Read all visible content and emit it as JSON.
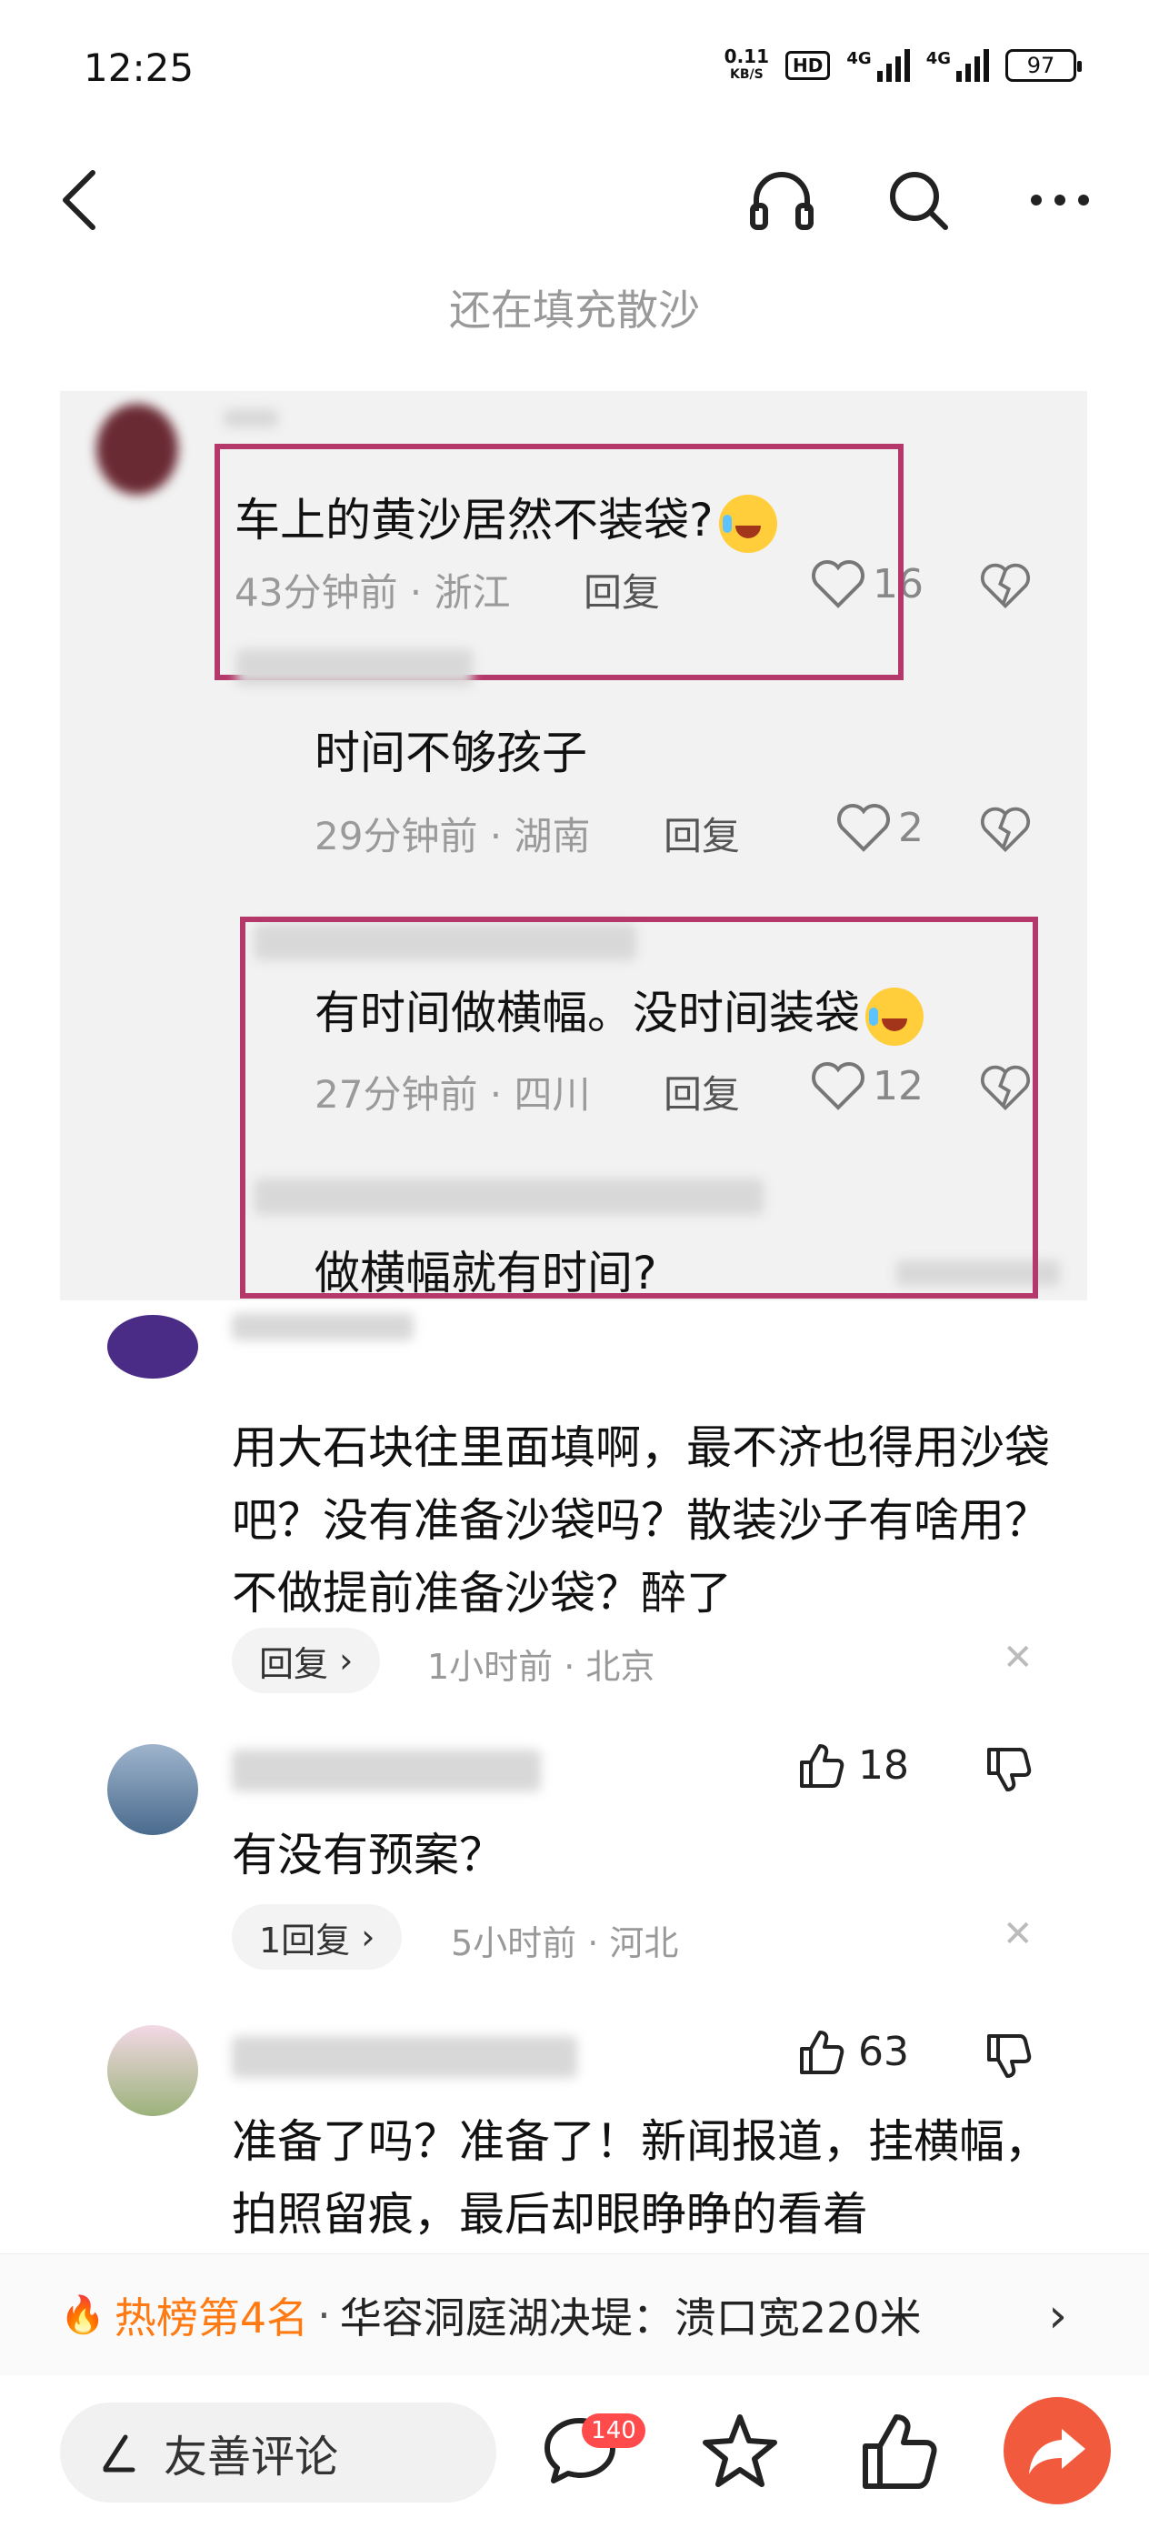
{
  "status_bar": {
    "time": "12:25",
    "net_speed_value": "0.11",
    "net_speed_unit": "KB/S",
    "hd_label": "HD",
    "sim1": "4G",
    "sim2": "4G",
    "battery": "97"
  },
  "nav": {
    "caption": "还在填充散沙",
    "icons": [
      "back-icon",
      "headphones-icon",
      "search-icon",
      "more-icon"
    ]
  },
  "inner_screenshot": {
    "comment": {
      "text": "车上的黄沙居然不装袋?",
      "time": "43分钟前",
      "location": "浙江",
      "reply": "回复",
      "likes": "16"
    },
    "replies": [
      {
        "text": "时间不够孩子",
        "time": "29分钟前",
        "location": "湖南",
        "reply": "回复",
        "likes": "2"
      },
      {
        "text": "有时间做横幅。没时间装袋",
        "time": "27分钟前",
        "location": "四川",
        "reply": "回复",
        "likes": "12"
      },
      {
        "text": "做横幅就有时间?"
      }
    ]
  },
  "comments": [
    {
      "text": "用大石块往里面填啊，最不济也得用沙袋吧？没有准备沙袋吗？散装沙子有啥用？不做提前准备沙袋？醉了",
      "reply_label": "回复",
      "time_location": "1小时前 · 北京"
    },
    {
      "text": "有没有预案？",
      "reply_label": "1回复",
      "time_location": "5小时前 · 河北",
      "likes": "18"
    },
    {
      "text": "准备了吗？准备了！新闻报道，挂横幅，拍照留痕，最后却眼睁睁的看着",
      "likes": "63"
    }
  ],
  "hot_banner": {
    "rank": "热榜第4名",
    "separator": "·",
    "title": "华容洞庭湖决堤：溃口宽220米"
  },
  "bottom_bar": {
    "input_placeholder": "友善评论",
    "comment_count": "140"
  },
  "colors": {
    "accent_orange": "#ff7a12",
    "highlight_box": "#b5386a",
    "share_button": "#f25a3d",
    "badge_red": "#ff4b4b"
  }
}
